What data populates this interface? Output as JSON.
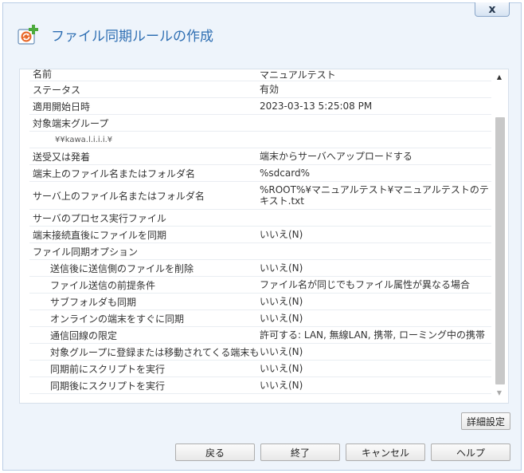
{
  "window": {
    "title": "ファイル同期ルールの作成",
    "close_label": "x"
  },
  "properties": [
    {
      "name": "名前",
      "value": "マニュアルテスト",
      "level": 0
    },
    {
      "name": "ステータス",
      "value": "有効",
      "level": 0
    },
    {
      "name": "適用開始日時",
      "value": "2023-03-13 5:25:08 PM",
      "level": 0
    },
    {
      "name": "対象端末グループ",
      "value": "",
      "level": 0
    },
    {
      "name": "¥¥kawa.l.i.i.i.¥",
      "value": "",
      "level": 2
    },
    {
      "name": "送受又は発着",
      "value": "端末からサーバへアップロードする",
      "level": 0
    },
    {
      "name": "端末上のファイル名またはフォルダ名",
      "value": "%sdcard%",
      "level": 0
    },
    {
      "name": "サーバ上のファイル名またはフォルダ名",
      "value": "%ROOT%¥マニュアルテスト¥マニュアルテストのテキスト.txt",
      "level": 0,
      "tall": true
    },
    {
      "name": "サーバのプロセス実行ファイル",
      "value": "",
      "level": 0
    },
    {
      "name": "端末接続直後にファイルを同期",
      "value": "いいえ(N)",
      "level": 0
    },
    {
      "name": "ファイル同期オプション",
      "value": "",
      "level": 0
    },
    {
      "name": "送信後に送信側のファイルを削除",
      "value": "いいえ(N)",
      "level": 1
    },
    {
      "name": "ファイル送信の前提条件",
      "value": "ファイル名が同じでもファイル属性が異なる場合",
      "level": 1
    },
    {
      "name": "サブフォルダも同期",
      "value": "いいえ(N)",
      "level": 1
    },
    {
      "name": "オンラインの端末をすぐに同期",
      "value": "いいえ(N)",
      "level": 1
    },
    {
      "name": "通信回線の限定",
      "value": "許可する: LAN, 無線LAN, 携帯, ローミング中の携帯",
      "level": 1
    },
    {
      "name": "対象グループに登録または移動されてくる端末も同",
      "value": "いいえ(N)",
      "level": 1
    },
    {
      "name": "同期前にスクリプトを実行",
      "value": "いいえ(N)",
      "level": 1
    },
    {
      "name": "同期後にスクリプトを実行",
      "value": "いいえ(N)",
      "level": 1
    }
  ],
  "buttons": {
    "detail": "詳細設定",
    "back": "戻る",
    "finish": "終了",
    "cancel": "キャンセル",
    "help": "ヘルプ"
  },
  "icons": {
    "app": "sync-rule-add-icon",
    "scroll_up": "scroll-up-arrow-icon",
    "scroll_down": "scroll-down-arrow-icon"
  },
  "colors": {
    "title": "#2f6fb3",
    "background": "#eef4fb"
  }
}
